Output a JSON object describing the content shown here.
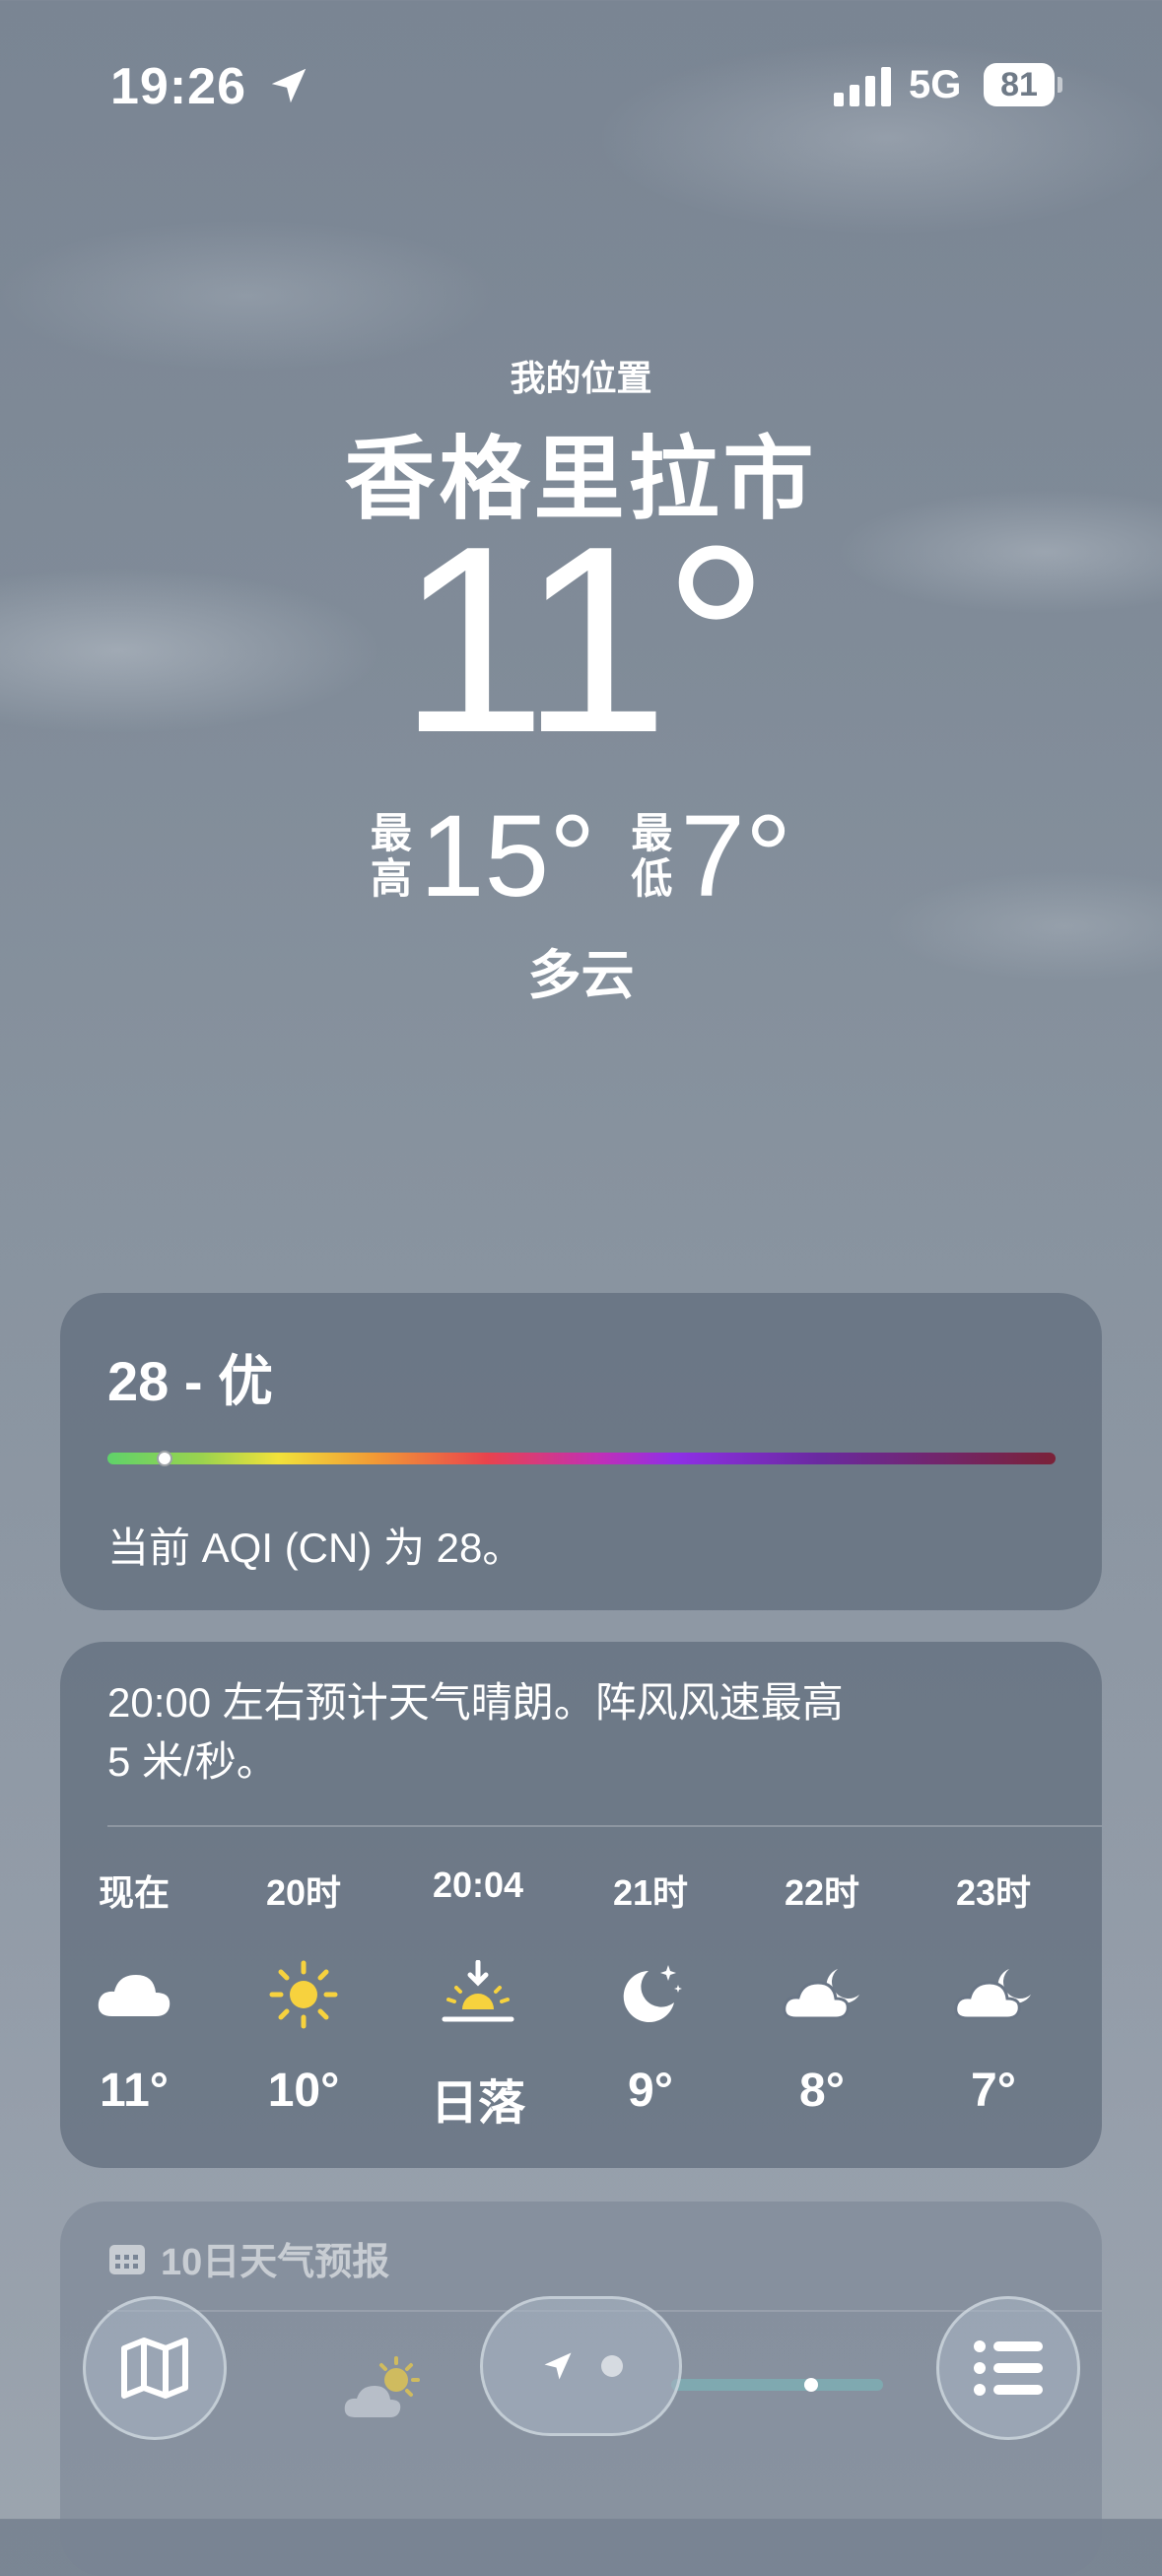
{
  "status_bar": {
    "time": "19:26",
    "network": "5G",
    "battery": "81",
    "icons": [
      "location-arrow-icon",
      "signal-icon",
      "battery-icon"
    ]
  },
  "header": {
    "my_location": "我的位置",
    "city": "香格里拉市",
    "current_temp": "11°",
    "high_label_1": "最",
    "high_label_2": "高",
    "high_value": "15°",
    "low_label_1": "最",
    "low_label_2": "低",
    "low_value": "7°",
    "condition": "多云"
  },
  "aqi": {
    "title": "28 - 优",
    "value": 28,
    "description": "当前 AQI (CN) 为 28。",
    "level_fraction": 0.06
  },
  "hourly": {
    "summary_line1": "20:00 左右预计天气晴朗。阵风风速最高",
    "summary_line2": "5 米/秒。",
    "items": [
      {
        "label": "现在",
        "icon": "cloud-icon",
        "temp": "11°"
      },
      {
        "label": "20时",
        "icon": "sun-icon",
        "temp": "10°"
      },
      {
        "label": "20:04",
        "icon": "sunset-icon",
        "temp": "日落"
      },
      {
        "label": "21时",
        "icon": "moon-stars-icon",
        "temp": "9°"
      },
      {
        "label": "22时",
        "icon": "cloud-moon-icon",
        "temp": "8°"
      },
      {
        "label": "23时",
        "icon": "cloud-moon-icon",
        "temp": "7°"
      }
    ]
  },
  "forecast": {
    "title": "10日天气预报",
    "icon": "calendar-icon"
  },
  "toolbar": {
    "icons": [
      "map-icon",
      "location-arrow-icon",
      "page-dot-icon",
      "list-icon"
    ]
  },
  "colors": {
    "card_bg": "#606c7c",
    "sun": "#f7d23e",
    "background_top": "#7a8593"
  }
}
